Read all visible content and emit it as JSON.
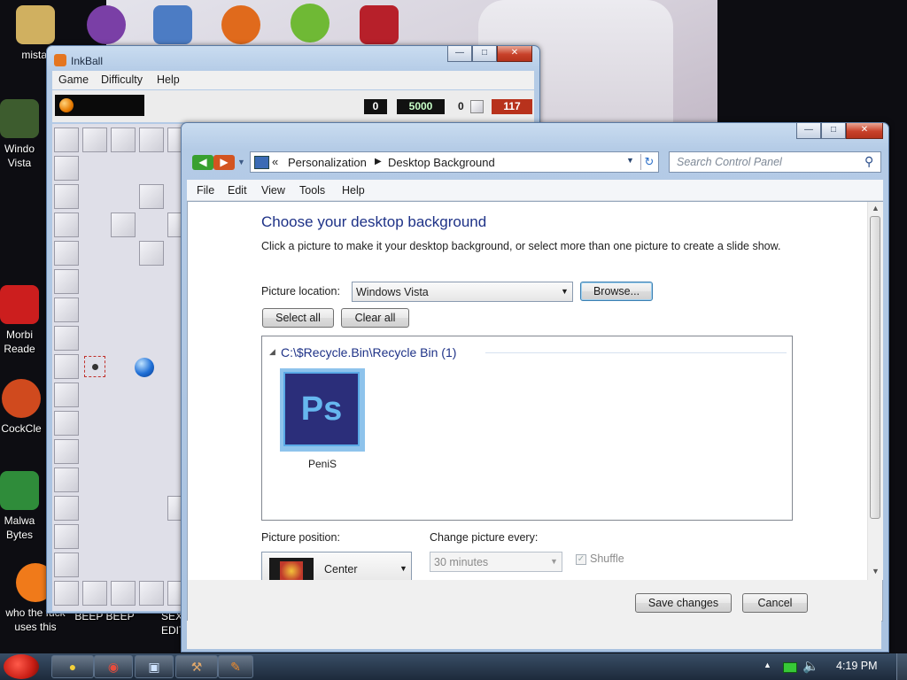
{
  "desktop": {
    "icons": [
      {
        "label": "mistal",
        "color": "#d0b060"
      },
      {
        "label": "",
        "color": "#7a3fa6"
      },
      {
        "label": "",
        "color": "#4c7cc4"
      },
      {
        "label": "",
        "color": "#e06a1c"
      },
      {
        "label": "",
        "color": "#6fb935"
      },
      {
        "label": "",
        "color": "#b7202a"
      },
      {
        "label": "Windo Vista",
        "color": "#3d5c2e"
      },
      {
        "label": "Morbi Reade",
        "color": "#cc1e1e"
      },
      {
        "label": "CockCle",
        "color": "#d04a1e"
      },
      {
        "label": "Malwa Bytes",
        "color": "#2f8c3a"
      },
      {
        "label": "who the fuck uses this",
        "color": "#f07a1a"
      },
      {
        "label": "BEEP BEEP",
        "color": ""
      },
      {
        "label": "SEX EDITIO",
        "color": ""
      }
    ]
  },
  "inkball": {
    "title": "InkBall",
    "menu": [
      "Game",
      "Difficulty",
      "Help"
    ],
    "score": {
      "left": "0",
      "center": "5000",
      "right_count": "0",
      "time": "117"
    }
  },
  "control_panel": {
    "breadcrumb": {
      "chevrons": "«",
      "items": [
        "Personalization",
        "Desktop Background"
      ]
    },
    "search_placeholder": "Search Control Panel",
    "menu": [
      "File",
      "Edit",
      "View",
      "Tools",
      "Help"
    ],
    "heading": "Choose your desktop background",
    "description": "Click a picture to make it your desktop background, or select more than one picture to create a slide show.",
    "picture_location_label": "Picture location:",
    "picture_location_value": "Windows Vista",
    "browse_label": "Browse...",
    "select_all_label": "Select all",
    "clear_all_label": "Clear all",
    "group_title": "C:\\$Recycle.Bin\\Recycle Bin (1)",
    "thumbnail": {
      "text": "Ps",
      "caption": "PeniS",
      "accent": "#2b2e7a"
    },
    "picture_position_label": "Picture position:",
    "picture_position_value": "Center",
    "change_every_label": "Change picture every:",
    "change_every_value": "30 minutes",
    "shuffle_label": "Shuffle",
    "save_label": "Save changes",
    "cancel_label": "Cancel"
  },
  "taskbar": {
    "clock": "4:19 PM",
    "items": [
      "ie",
      "chrome",
      "explorer",
      "tool",
      "inkball"
    ]
  }
}
